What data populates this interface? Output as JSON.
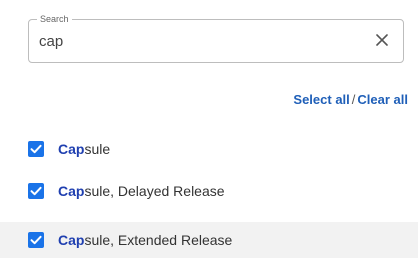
{
  "search": {
    "legend": "Search",
    "value": "cap",
    "clear_icon": "close-icon"
  },
  "actions": {
    "select_all": "Select all",
    "separator": "/",
    "clear_all": "Clear all",
    "color": "#1f5fb8"
  },
  "options": [
    {
      "match": "Cap",
      "rest": "sule",
      "checked": true,
      "highlighted": false
    },
    {
      "match": "Cap",
      "rest": "sule, Delayed Release",
      "checked": true,
      "highlighted": false
    },
    {
      "match": "Cap",
      "rest": "sule, Extended Release",
      "checked": true,
      "highlighted": true
    }
  ],
  "colors": {
    "checkbox": "#1a73e8",
    "match_text": "#1f3fb0",
    "highlight_row": "#f2f2f2"
  }
}
